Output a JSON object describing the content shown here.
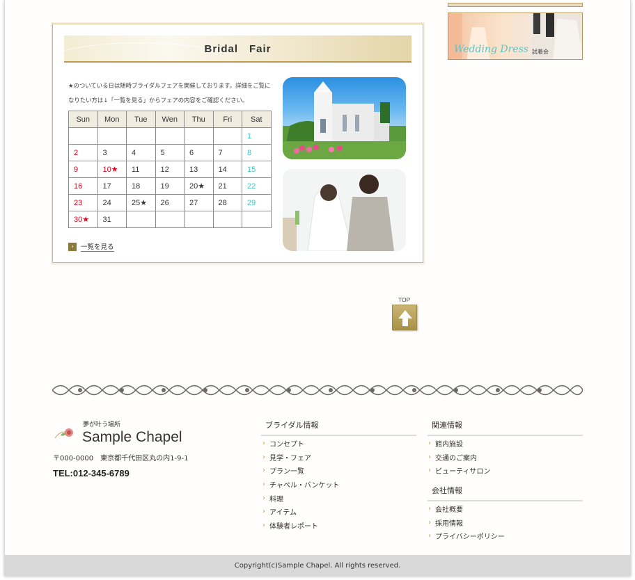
{
  "fair": {
    "title": "Bridal　Fair",
    "description": "★のついている日は随時ブライダルフェアを開催しております。詳細をご覧になりたい方は↓「一覧を見る」からフェアの内容をご確認ください。",
    "weekdays": [
      "Sun",
      "Mon",
      "Tue",
      "Wen",
      "Thu",
      "Fri",
      "Sat"
    ],
    "weeks": [
      [
        "",
        "",
        "",
        "",
        "",
        "",
        "1"
      ],
      [
        "2",
        "3",
        "4",
        "5",
        "6",
        "7",
        "8"
      ],
      [
        "9",
        "10★",
        "11",
        "12",
        "13",
        "14",
        "15"
      ],
      [
        "16",
        "17",
        "18",
        "19",
        "20★",
        "21",
        "22"
      ],
      [
        "23",
        "24",
        "25★",
        "26",
        "27",
        "28",
        "29"
      ],
      [
        "30★",
        "31",
        "",
        "",
        "",
        "",
        ""
      ]
    ],
    "more_label": "一覧を見る",
    "sunday_color": "#e0001e",
    "saturday_color": "#3ec6c6"
  },
  "banner": {
    "script_text": "Wedding Dress",
    "label": "試着会"
  },
  "top_button": {
    "label": "TOP"
  },
  "footer": {
    "tagline": "夢が叶う場所",
    "brand": "Sample Chapel",
    "address": "〒000-0000　東京都千代田区丸の内1-9-1",
    "tel": "TEL:012-345-6789",
    "bridal": {
      "title": "ブライダル情報",
      "items": [
        "コンセプト",
        "見学・フェア",
        "プラン一覧",
        "チャペル・バンケット",
        "料理",
        "アイテム",
        "体験者レポート"
      ]
    },
    "related": {
      "title": "関連情報",
      "items": [
        "館内施設",
        "交通のご案内",
        "ビューティサロン"
      ]
    },
    "company": {
      "title": "会社情報",
      "items": [
        "会社概要",
        "採用情報",
        "プライバシーポリシー"
      ]
    },
    "copyright": "Copyright(c)Sample Chapel. All rights reserved."
  },
  "icons": {
    "more": "chevron-right-icon",
    "top": "arrow-up-icon",
    "list": "chevron-right-icon",
    "logo": "rose-icon"
  },
  "accent_color": "#b89c52"
}
